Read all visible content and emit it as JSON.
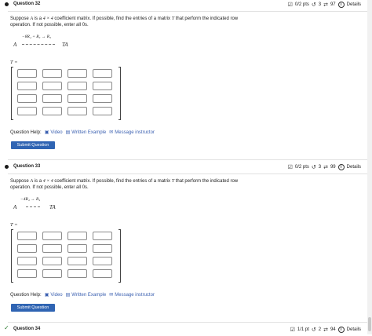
{
  "questions": [
    {
      "title": "Question 32",
      "points": "0/2 pts",
      "retries": "3",
      "attempts": "97",
      "details": "Details",
      "text_a": "Suppose ",
      "A": "A",
      "text_b": " is a ",
      "dims": "4 × 4",
      "text_c": " coefficient matrix. If possible, find the entries of a matrix ",
      "T": "T",
      "text_d": " that perform the indicated row operation. If not possible, enter all 0s.",
      "op": "−8R₄ + R₃ → R₃",
      "lhs": "A",
      "rhs": "TA",
      "t_label": "T ="
    },
    {
      "title": "Question 33",
      "points": "0/2 pts",
      "retries": "3",
      "attempts": "99",
      "details": "Details",
      "text_a": "Suppose ",
      "A": "A",
      "text_b": " is a ",
      "dims": "4 × 4",
      "text_c": " coefficient matrix. If possible, find the entries of a matrix ",
      "T": "T",
      "text_d": " that perform the indicated row operation. If not possible, enter all 0s.",
      "op": "−4R₄ → R₄",
      "lhs": "A",
      "rhs": "TA",
      "t_label": "T ="
    },
    {
      "title": "Question 34",
      "points": "1/1 pt",
      "retries": "2",
      "attempts": "94",
      "details": "Details"
    }
  ],
  "help": {
    "label": "Question Help:",
    "video": "Video",
    "example": "Written Example",
    "message": "Message instructor"
  },
  "submit_label": "Submit Question"
}
